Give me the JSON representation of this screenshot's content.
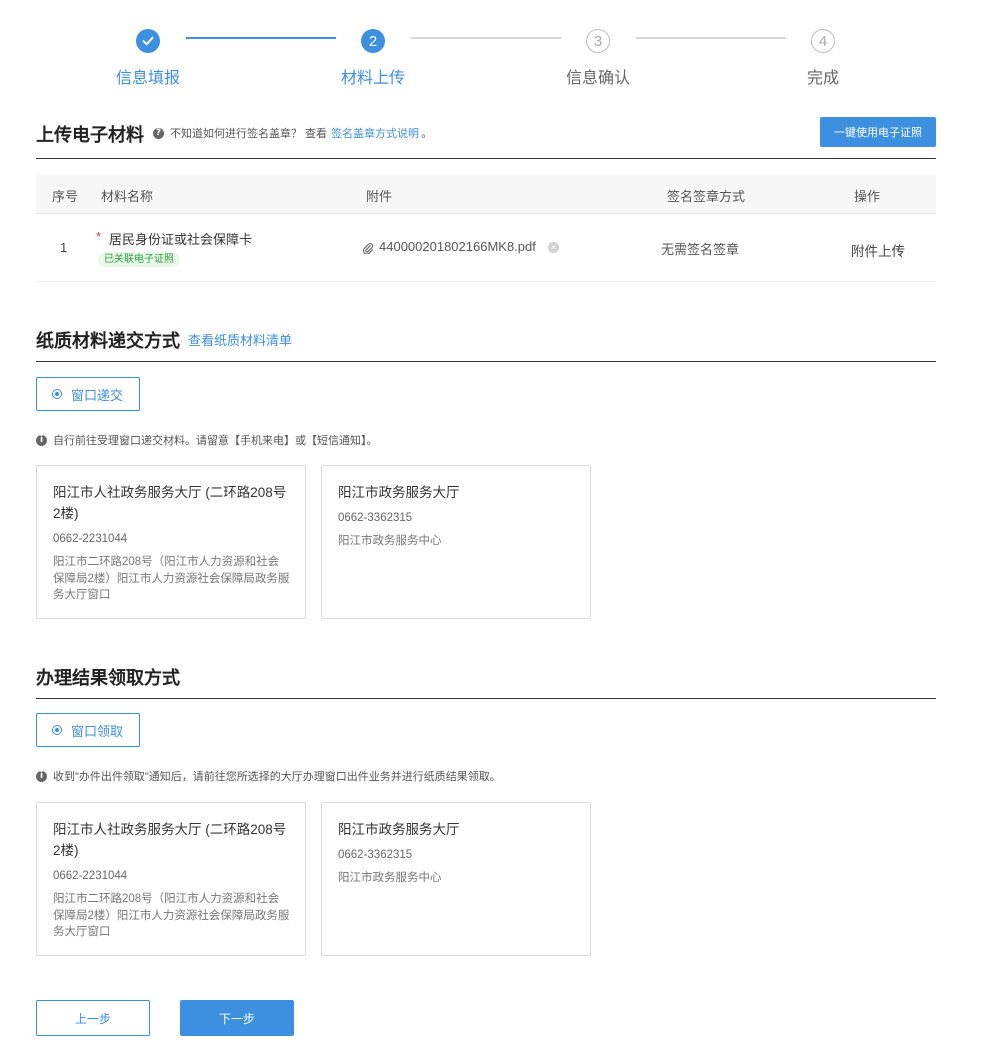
{
  "steps": [
    {
      "label": "信息填报",
      "number": "",
      "state": "done"
    },
    {
      "label": "材料上传",
      "number": "2",
      "state": "active"
    },
    {
      "label": "信息确认",
      "number": "3",
      "state": "todo"
    },
    {
      "label": "完成",
      "number": "4",
      "state": "todo"
    }
  ],
  "upload": {
    "title": "上传电子材料",
    "hint": "不知道如何进行签名盖章？ 查看",
    "hint_link": "签名盖章方式说明",
    "hint_end": "。",
    "ecert_button": "一键使用电子证照",
    "columns": [
      "序号",
      "材料名称",
      "附件",
      "签名签章方式",
      "操作"
    ],
    "rows": [
      {
        "index": "1",
        "required_mark": "*",
        "name": "居民身份证或社会保障卡",
        "tag": "已关联电子证照",
        "attachment": "440000201802166MK8.pdf",
        "sign_method": "无需签名签章",
        "action": "附件上传"
      }
    ]
  },
  "paper": {
    "title": "纸质材料递交方式",
    "link": "查看纸质材料清单",
    "option": "窗口递交",
    "note": "自行前往受理窗口递交材料。请留意【手机来电】或【短信通知】。",
    "halls": [
      {
        "name": "阳江市人社政务服务大厅 (二环路208号2楼)",
        "phone": "0662-2231044",
        "address": "阳江市二环路208号（阳江市人力资源和社会保障局2楼）阳江市人力资源社会保障局政务服务大厅窗口"
      },
      {
        "name": "阳江市政务服务大厅",
        "phone": "0662-3362315",
        "address": "阳江市政务服务中心"
      }
    ]
  },
  "result": {
    "title": "办理结果领取方式",
    "option": "窗口领取",
    "note": "收到\"办件出件领取\"通知后，请前往您所选择的大厅办理窗口出件业务并进行纸质结果领取。",
    "halls": [
      {
        "name": "阳江市人社政务服务大厅 (二环路208号2楼)",
        "phone": "0662-2231044",
        "address": "阳江市二环路208号（阳江市人力资源和社会保障局2楼）阳江市人力资源社会保障局政务服务大厅窗口"
      },
      {
        "name": "阳江市政务服务大厅",
        "phone": "0662-3362315",
        "address": "阳江市政务服务中心"
      }
    ]
  },
  "footer": {
    "prev": "上一步",
    "next": "下一步"
  },
  "colors": {
    "accent": "#3d8fe0",
    "tag_bg": "#e8f8e8",
    "tag_text": "#2ea043",
    "required": "#e4393c"
  }
}
